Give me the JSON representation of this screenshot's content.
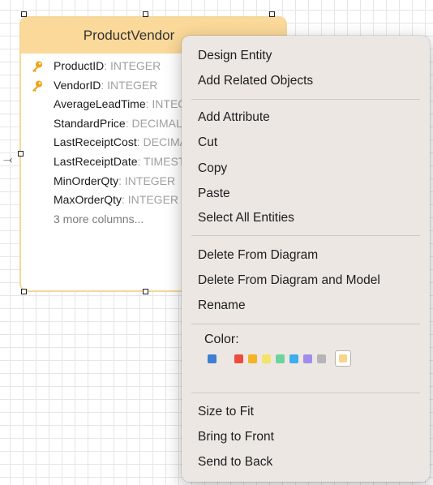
{
  "entity": {
    "title": "ProductVendor",
    "columns": [
      {
        "name": "ProductID",
        "type": ": INTEGER",
        "key": true
      },
      {
        "name": "VendorID",
        "type": ": INTEGER",
        "key": true
      },
      {
        "name": "AverageLeadTime",
        "type": ": INTEGER",
        "key": false
      },
      {
        "name": "StandardPrice",
        "type": ": DECIMAL",
        "key": false
      },
      {
        "name": "LastReceiptCost",
        "type": ": DECIMAL",
        "key": false
      },
      {
        "name": "LastReceiptDate",
        "type": ": TIMESTAMP",
        "key": false
      },
      {
        "name": "MinOrderQty",
        "type": ": INTEGER",
        "key": false
      },
      {
        "name": "MaxOrderQty",
        "type": ": INTEGER",
        "key": false
      }
    ],
    "more_columns": "3 more columns...",
    "header_color": "#fbd99a",
    "key_icon": "key-icon"
  },
  "context_menu": {
    "group1": [
      "Design Entity",
      "Add Related Objects"
    ],
    "group2": [
      "Add Attribute",
      "Cut",
      "Copy",
      "Paste",
      "Select All Entities"
    ],
    "group3": [
      "Delete From Diagram",
      "Delete From Diagram and Model",
      "Rename"
    ],
    "color_label": "Color:",
    "colors": [
      "#3f7fd1",
      "#ef4a3e",
      "#f4b326",
      "#f4e36a",
      "#6dd39c",
      "#3daeee",
      "#9f8ced",
      "#b5b5b8"
    ],
    "selected_color": "#f9d489",
    "group4": [
      "Size to Fit",
      "Bring to Front",
      "Send to Back"
    ]
  }
}
